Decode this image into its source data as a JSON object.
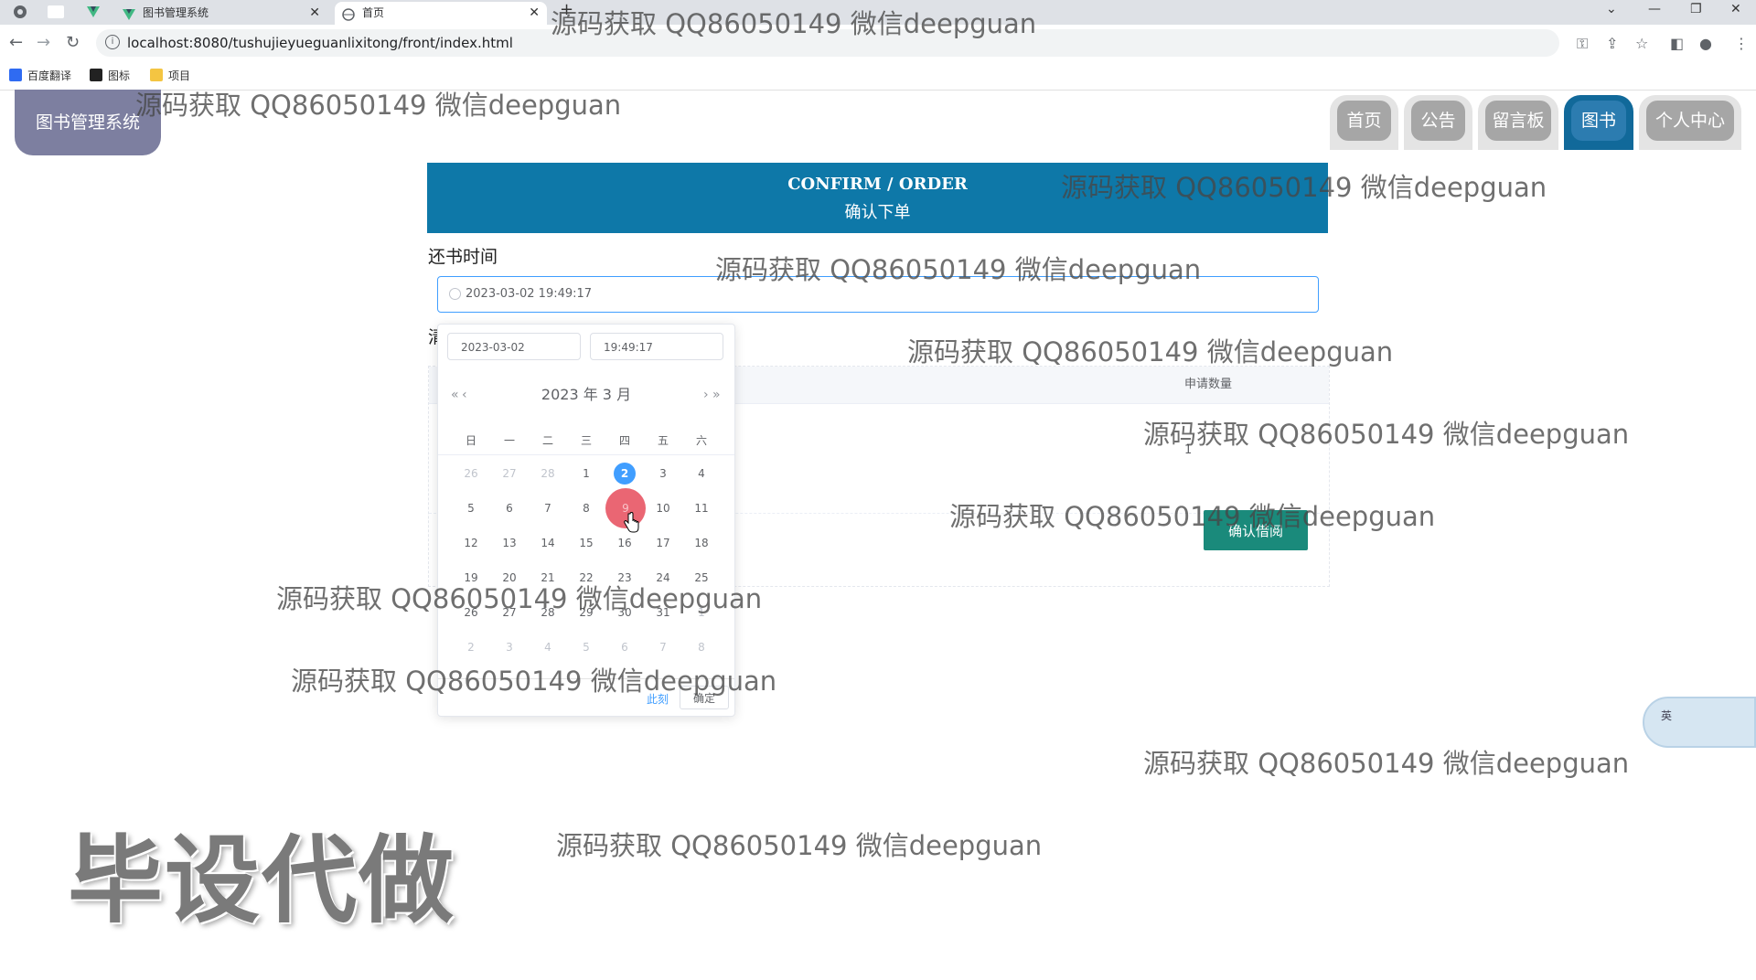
{
  "browser": {
    "tabs": [
      {
        "title": "图书管理系统",
        "active": false
      },
      {
        "title": "首页",
        "active": true
      }
    ],
    "url": "localhost:8080/tushujieyueguanlixitong/front/index.html",
    "bookmarks": [
      "百度翻译",
      "图标",
      "项目"
    ]
  },
  "site": {
    "logo": "图书管理系统",
    "nav": [
      {
        "label": "首页",
        "active": false
      },
      {
        "label": "公告",
        "active": false
      },
      {
        "label": "留言板",
        "active": false
      },
      {
        "label": "图书",
        "active": true
      },
      {
        "label": "个人中心",
        "active": false
      }
    ]
  },
  "banner": {
    "title_en": "CONFIRM / ORDER",
    "title_cn": "确认下单"
  },
  "form": {
    "return_time_label": "还书时间",
    "return_time_value": "2023-03-02 19:49:17",
    "second_label": "清"
  },
  "table": {
    "column": "申请数量",
    "quantity": "1"
  },
  "confirm_borrow_label": "确认借阅",
  "datepicker": {
    "date_value": "2023-03-02",
    "time_value": "19:49:17",
    "prev_year": "«",
    "prev_month": "‹",
    "next_month": "›",
    "next_year": "»",
    "title": "2023 年  3 月",
    "weekdays": [
      "日",
      "一",
      "二",
      "三",
      "四",
      "五",
      "六"
    ],
    "today": "2",
    "hover": "9",
    "weeks": [
      [
        "26",
        "27",
        "28",
        "1",
        "2",
        "3",
        "4"
      ],
      [
        "5",
        "6",
        "7",
        "8",
        "9",
        "10",
        "11"
      ],
      [
        "12",
        "13",
        "14",
        "15",
        "16",
        "17",
        "18"
      ],
      [
        "19",
        "20",
        "21",
        "22",
        "23",
        "24",
        "25"
      ],
      [
        "26",
        "27",
        "28",
        "29",
        "30",
        "31",
        "1"
      ],
      [
        "2",
        "3",
        "4",
        "5",
        "6",
        "7",
        "8"
      ]
    ],
    "now_label": "此刻",
    "ok_label": "确定"
  },
  "watermark_text": "源码获取 QQ86050149 微信deepguan",
  "big_watermark": "毕设代做",
  "ime_label": "英",
  "colors": {
    "primary": "#409eff",
    "banner": "#0e78a8",
    "nav_active": "#11699a",
    "confirm": "#1a8a7b"
  }
}
